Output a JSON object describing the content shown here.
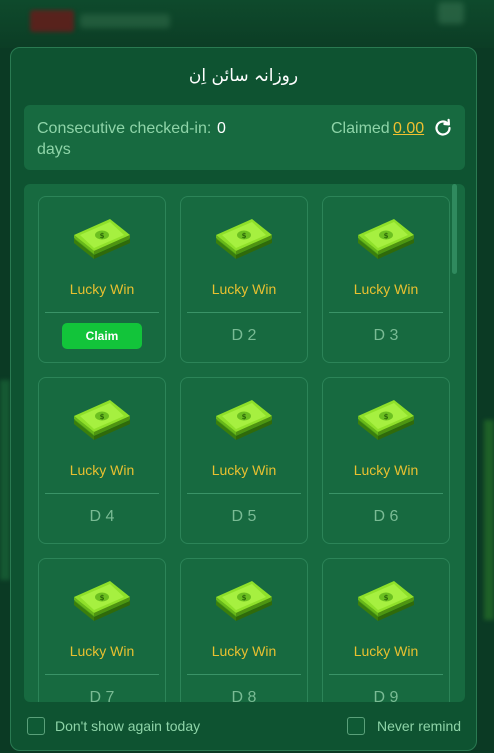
{
  "background": {
    "app_title": ""
  },
  "modal": {
    "title": "روزانہ سائن اِن",
    "consecutive_label": "Consecutive checked-in: days",
    "consecutive_count": "0",
    "claimed_label": "Claimed",
    "claimed_value": "0.00",
    "refresh_icon": "refresh-icon",
    "reward_icon": "cash-stack-icon",
    "colors": {
      "accent_gold": "#e8c030",
      "claim_green": "#12c43a",
      "panel": "#176a40"
    }
  },
  "cards": [
    {
      "label": "Lucky Win",
      "day": "",
      "action": "Claim"
    },
    {
      "label": "Lucky Win",
      "day": "D 2"
    },
    {
      "label": "Lucky Win",
      "day": "D 3"
    },
    {
      "label": "Lucky Win",
      "day": "D 4"
    },
    {
      "label": "Lucky Win",
      "day": "D 5"
    },
    {
      "label": "Lucky Win",
      "day": "D 6"
    },
    {
      "label": "Lucky Win",
      "day": "D 7"
    },
    {
      "label": "Lucky Win",
      "day": "D 8"
    },
    {
      "label": "Lucky Win",
      "day": "D 9"
    }
  ],
  "footer": {
    "dont_show_today": "Don't show again today",
    "never_remind": "Never remind"
  }
}
